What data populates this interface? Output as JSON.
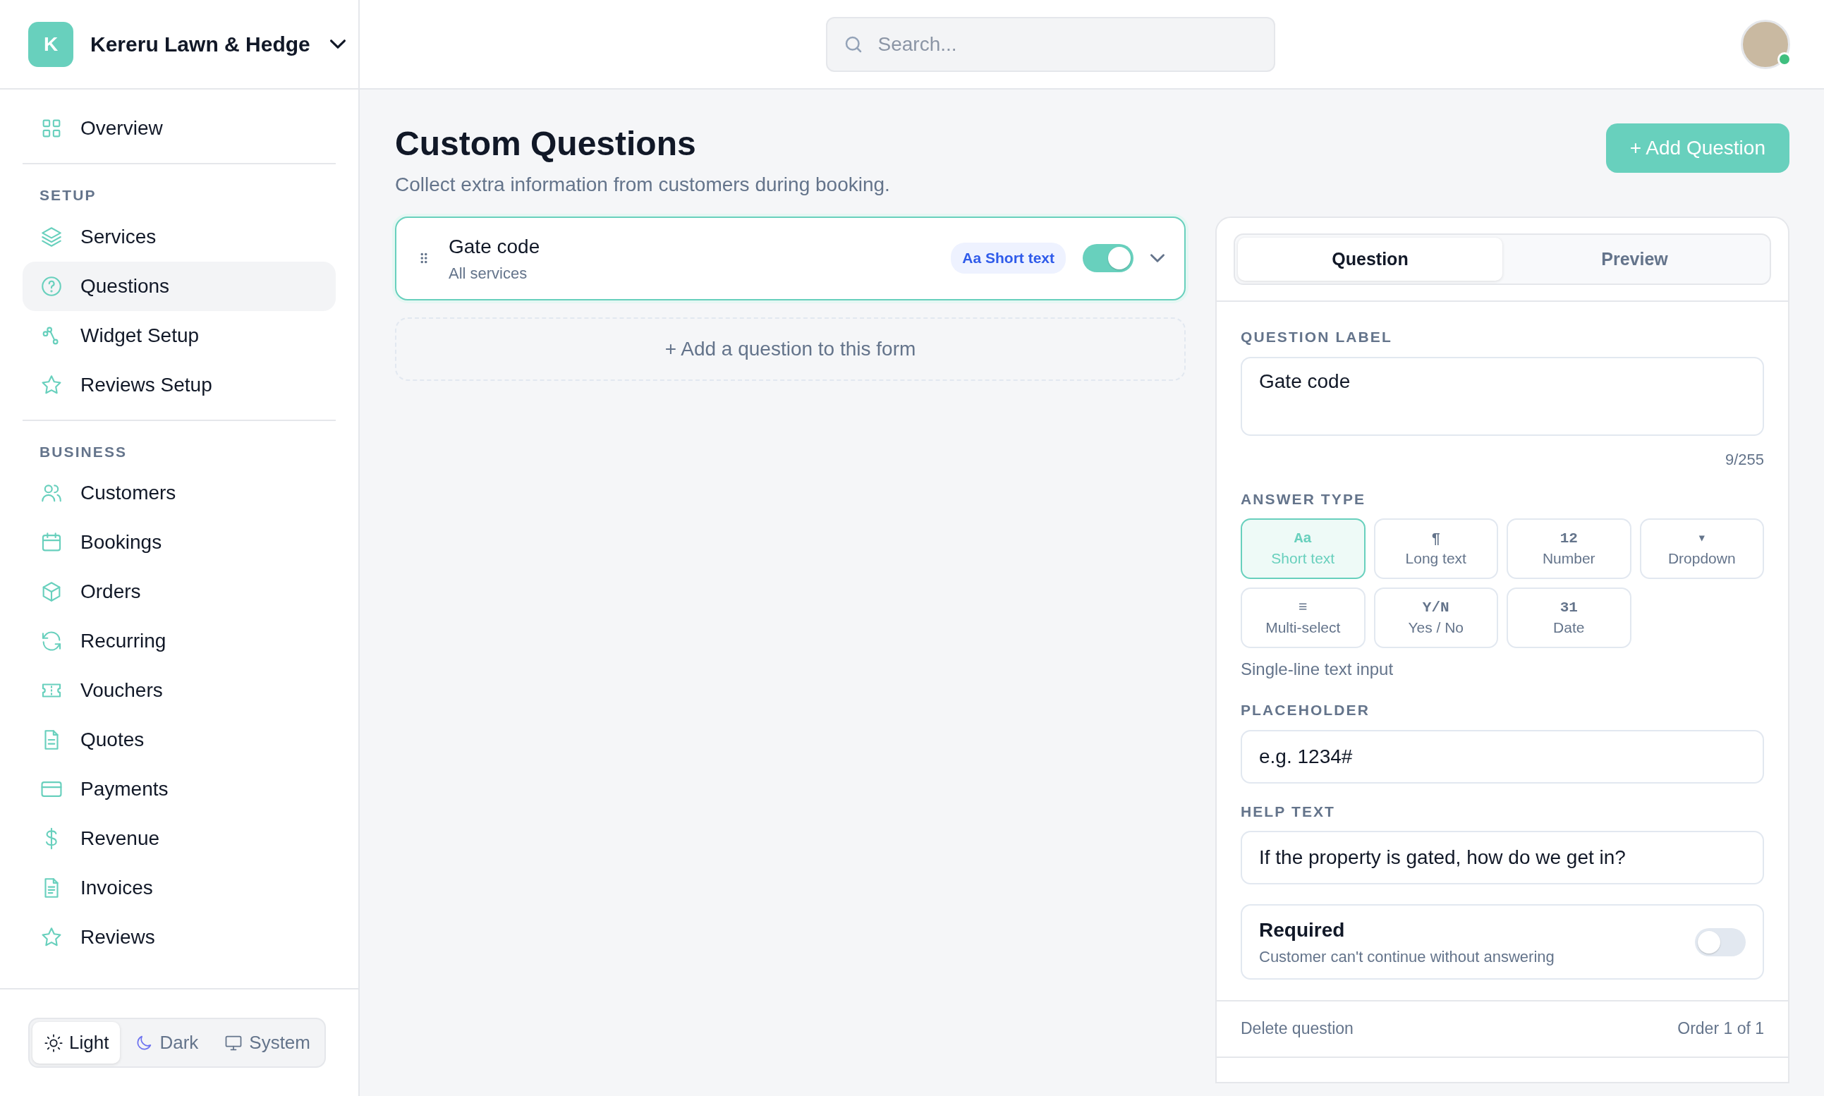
{
  "workspace": {
    "initial": "K",
    "name": "Kereru Lawn & Hedge"
  },
  "search": {
    "placeholder": "Search..."
  },
  "user": {
    "online": true
  },
  "sidebar": {
    "sections": [
      {
        "items": [
          {
            "label": "Overview",
            "selected": false
          }
        ]
      },
      {
        "heading": "SETUP",
        "items": [
          {
            "label": "Services",
            "selected": false
          },
          {
            "label": "Questions",
            "selected": true
          },
          {
            "label": "Widget Setup",
            "selected": false
          },
          {
            "label": "Reviews Setup",
            "selected": false
          }
        ]
      },
      {
        "heading": "BUSINESS",
        "items": [
          {
            "label": "Customers",
            "selected": false
          },
          {
            "label": "Bookings",
            "selected": false
          },
          {
            "label": "Orders",
            "selected": false
          },
          {
            "label": "Recurring",
            "selected": false
          },
          {
            "label": "Vouchers",
            "selected": false
          },
          {
            "label": "Quotes",
            "selected": false
          },
          {
            "label": "Payments",
            "selected": false
          },
          {
            "label": "Revenue",
            "selected": false
          },
          {
            "label": "Invoices",
            "selected": false
          },
          {
            "label": "Reviews",
            "selected": false
          }
        ]
      }
    ]
  },
  "theme_switcher": [
    {
      "label": "Light",
      "selected": true
    },
    {
      "label": "Dark",
      "selected": false
    },
    {
      "label": "System",
      "selected": false
    }
  ],
  "page": {
    "title": "Custom Questions",
    "subtitle": "Collect extra information from customers during booking.",
    "add_button": "+ Add Question"
  },
  "questions": [
    {
      "title": "Gate code",
      "scope": "All services",
      "badge": "Aa Short text",
      "enabled": true,
      "selected": true
    }
  ],
  "add_question_prompt": "+ Add a question to this form",
  "editor": {
    "tabs": [
      {
        "label": "Question",
        "selected": true
      },
      {
        "label": "Preview",
        "selected": false
      }
    ],
    "question_label": {
      "label": "QUESTION LABEL",
      "value": "Gate code",
      "counter": "9/255"
    },
    "answer_type": {
      "label": "ANSWER TYPE",
      "hint": "Single-line text input",
      "options": [
        {
          "glyph": "Aa",
          "label": "Short text",
          "selected": true
        },
        {
          "glyph": "¶",
          "label": "Long text",
          "selected": false
        },
        {
          "glyph": "12",
          "label": "Number",
          "selected": false
        },
        {
          "glyph": "▾",
          "label": "Dropdown",
          "selected": false
        },
        {
          "glyph": "≡",
          "label": "Multi-select",
          "selected": false
        },
        {
          "glyph": "Y/N",
          "label": "Yes / No",
          "selected": false
        },
        {
          "glyph": "31",
          "label": "Date",
          "selected": false
        }
      ]
    },
    "placeholder": {
      "label": "PLACEHOLDER",
      "value": "e.g. 1234#"
    },
    "help_text": {
      "label": "HELP TEXT",
      "value": "If the property is gated, how do we get in?"
    },
    "required": {
      "title": "Required",
      "description": "Customer can't continue without answering",
      "on": false
    },
    "delete": "Delete question",
    "order": "Order 1 of 1"
  }
}
